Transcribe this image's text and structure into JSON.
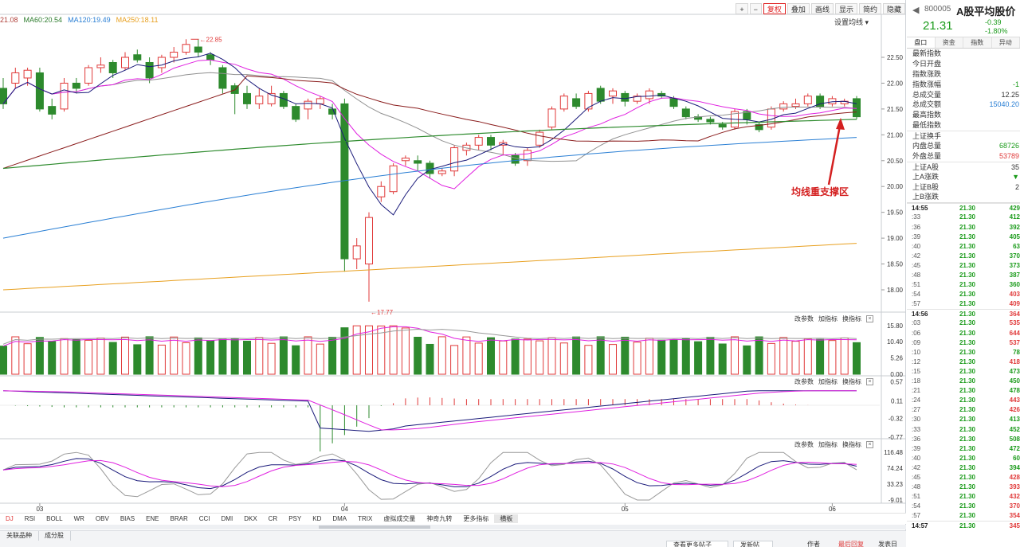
{
  "toolbar": {
    "buttons": [
      "+",
      "−",
      "复权",
      "叠加",
      "画线",
      "显示",
      "简约",
      "隐藏"
    ],
    "active_index": 2
  },
  "ma_legend": [
    {
      "label": "21.08",
      "color": "#b0403a"
    },
    {
      "label": "MA60:20.54",
      "color": "#2e7d2e"
    },
    {
      "label": "MA120:19.49",
      "color": "#2a7fd4"
    },
    {
      "label": "MA250:18.11",
      "color": "#e8a020"
    }
  ],
  "set_ma_label": "设置均线",
  "price_axis": [
    "22.50",
    "22.00",
    "21.50",
    "21.00",
    "20.50",
    "20.00",
    "19.50",
    "19.00",
    "18.50",
    "18.00"
  ],
  "annotations": {
    "high": "22.85",
    "low": "17.77",
    "support": "均线重支撑区"
  },
  "colors": {
    "up": "#e03a3a",
    "down": "#2d8a2d",
    "ma5": "#1a1a7a",
    "ma10": "#e020e0",
    "ma20": "#909090",
    "ma30": "#8a1c1c",
    "ma60": "#2e8b2e",
    "ma120": "#2a7fd4",
    "ma250": "#e8a020"
  },
  "panels": {
    "tools": [
      "改参数",
      "加指标",
      "换指标"
    ],
    "volume_axis": [
      "15.80",
      "10.40",
      "5.26",
      "0.00"
    ],
    "macd_axis": [
      "0.57",
      "0.11",
      "-0.32",
      "-0.77"
    ],
    "kdj_axis": [
      "116.48",
      "74.24",
      "33.23",
      "-9.01"
    ]
  },
  "x_axis": [
    "03",
    "04",
    "05",
    "06"
  ],
  "indicator_tabs": [
    "DJ",
    "RSI",
    "BOLL",
    "WR",
    "OBV",
    "BIAS",
    "ENE",
    "BRAR",
    "CCI",
    "DMI",
    "DKX",
    "CR",
    "PSY",
    "KD",
    "DMA",
    "TRIX",
    "虚拟成交量",
    "神奇九转",
    "更多指标",
    "横板"
  ],
  "indicator_current": 19,
  "bottom": {
    "tabs": [
      "关联品种",
      "成分股"
    ],
    "buttons": [
      "查看更多帖子",
      "发新帖",
      "作者",
      "最后回复1",
      "发表日"
    ]
  },
  "side": {
    "code": "800005",
    "name": "A股平均股价",
    "price": "21.31",
    "change": "-0.39",
    "change_pct": "-1.80%",
    "tabs": [
      "盘口",
      "资金",
      "指数",
      "异动"
    ],
    "info": [
      {
        "label": "最新指数",
        "value": "",
        "color": "#333"
      },
      {
        "label": "今日开盘",
        "value": "",
        "color": "#333"
      },
      {
        "label": "指数涨跌",
        "value": "",
        "color": "#333"
      },
      {
        "label": "指数涨幅",
        "value": "-1",
        "color": "#1b9b1b"
      },
      {
        "label": "总成交量",
        "value": "12.25",
        "color": "#333"
      },
      {
        "label": "总成交额",
        "value": "15040.20",
        "color": "#2a7fd4"
      },
      {
        "label": "最高指数",
        "value": "",
        "color": "#333"
      },
      {
        "label": "最低指数",
        "value": "",
        "color": "#333"
      },
      {
        "label": "上证换手",
        "value": "",
        "color": "#333"
      },
      {
        "label": "内盘总量",
        "value": "68726",
        "color": "#1b9b1b"
      },
      {
        "label": "外盘总量",
        "value": "53789",
        "color": "#e03a3a"
      },
      {
        "label": "上证A股",
        "value": "35",
        "color": "#333"
      },
      {
        "label": "上A涨跌",
        "value": "▼",
        "color": "#1b9b1b"
      },
      {
        "label": "上证B股",
        "value": "2",
        "color": "#333"
      },
      {
        "label": "上B涨跌",
        "value": "",
        "color": "#333"
      }
    ],
    "ticks": [
      {
        "t": "14:55",
        "p": "21.30",
        "v": "429",
        "c": "#1b9b1b"
      },
      {
        "t": ":33",
        "p": "21.30",
        "v": "412",
        "c": "#1b9b1b"
      },
      {
        "t": ":36",
        "p": "21.30",
        "v": "392",
        "c": "#1b9b1b"
      },
      {
        "t": ":39",
        "p": "21.30",
        "v": "405",
        "c": "#1b9b1b"
      },
      {
        "t": ":40",
        "p": "21.30",
        "v": "63",
        "c": "#1b9b1b"
      },
      {
        "t": ":42",
        "p": "21.30",
        "v": "370",
        "c": "#1b9b1b"
      },
      {
        "t": ":45",
        "p": "21.30",
        "v": "373",
        "c": "#1b9b1b"
      },
      {
        "t": ":48",
        "p": "21.30",
        "v": "387",
        "c": "#1b9b1b"
      },
      {
        "t": ":51",
        "p": "21.30",
        "v": "360",
        "c": "#1b9b1b"
      },
      {
        "t": ":54",
        "p": "21.30",
        "v": "403",
        "c": "#e03a3a"
      },
      {
        "t": ":57",
        "p": "21.30",
        "v": "409",
        "c": "#e03a3a"
      },
      {
        "t": "14:56",
        "p": "21.30",
        "v": "364",
        "c": "#e03a3a"
      },
      {
        "t": ":03",
        "p": "21.30",
        "v": "535",
        "c": "#e03a3a"
      },
      {
        "t": ":06",
        "p": "21.30",
        "v": "644",
        "c": "#e03a3a"
      },
      {
        "t": ":09",
        "p": "21.30",
        "v": "537",
        "c": "#e03a3a"
      },
      {
        "t": ":10",
        "p": "21.30",
        "v": "78",
        "c": "#1b9b1b"
      },
      {
        "t": ":12",
        "p": "21.30",
        "v": "418",
        "c": "#e03a3a"
      },
      {
        "t": ":15",
        "p": "21.30",
        "v": "473",
        "c": "#1b9b1b"
      },
      {
        "t": ":18",
        "p": "21.30",
        "v": "450",
        "c": "#1b9b1b"
      },
      {
        "t": ":21",
        "p": "21.30",
        "v": "478",
        "c": "#1b9b1b"
      },
      {
        "t": ":24",
        "p": "21.30",
        "v": "443",
        "c": "#e03a3a"
      },
      {
        "t": ":27",
        "p": "21.30",
        "v": "426",
        "c": "#e03a3a"
      },
      {
        "t": ":30",
        "p": "21.30",
        "v": "413",
        "c": "#1b9b1b"
      },
      {
        "t": ":33",
        "p": "21.30",
        "v": "452",
        "c": "#1b9b1b"
      },
      {
        "t": ":36",
        "p": "21.30",
        "v": "508",
        "c": "#1b9b1b"
      },
      {
        "t": ":39",
        "p": "21.30",
        "v": "472",
        "c": "#1b9b1b"
      },
      {
        "t": ":40",
        "p": "21.30",
        "v": "60",
        "c": "#1b9b1b"
      },
      {
        "t": ":42",
        "p": "21.30",
        "v": "394",
        "c": "#1b9b1b"
      },
      {
        "t": ":45",
        "p": "21.30",
        "v": "428",
        "c": "#e03a3a"
      },
      {
        "t": ":48",
        "p": "21.30",
        "v": "393",
        "c": "#e03a3a"
      },
      {
        "t": ":51",
        "p": "21.30",
        "v": "432",
        "c": "#e03a3a"
      },
      {
        "t": ":54",
        "p": "21.30",
        "v": "370",
        "c": "#e03a3a"
      },
      {
        "t": ":57",
        "p": "21.30",
        "v": "354",
        "c": "#e03a3a"
      },
      {
        "t": "14:57",
        "p": "21.30",
        "v": "345",
        "c": "#e03a3a"
      }
    ]
  }
}
